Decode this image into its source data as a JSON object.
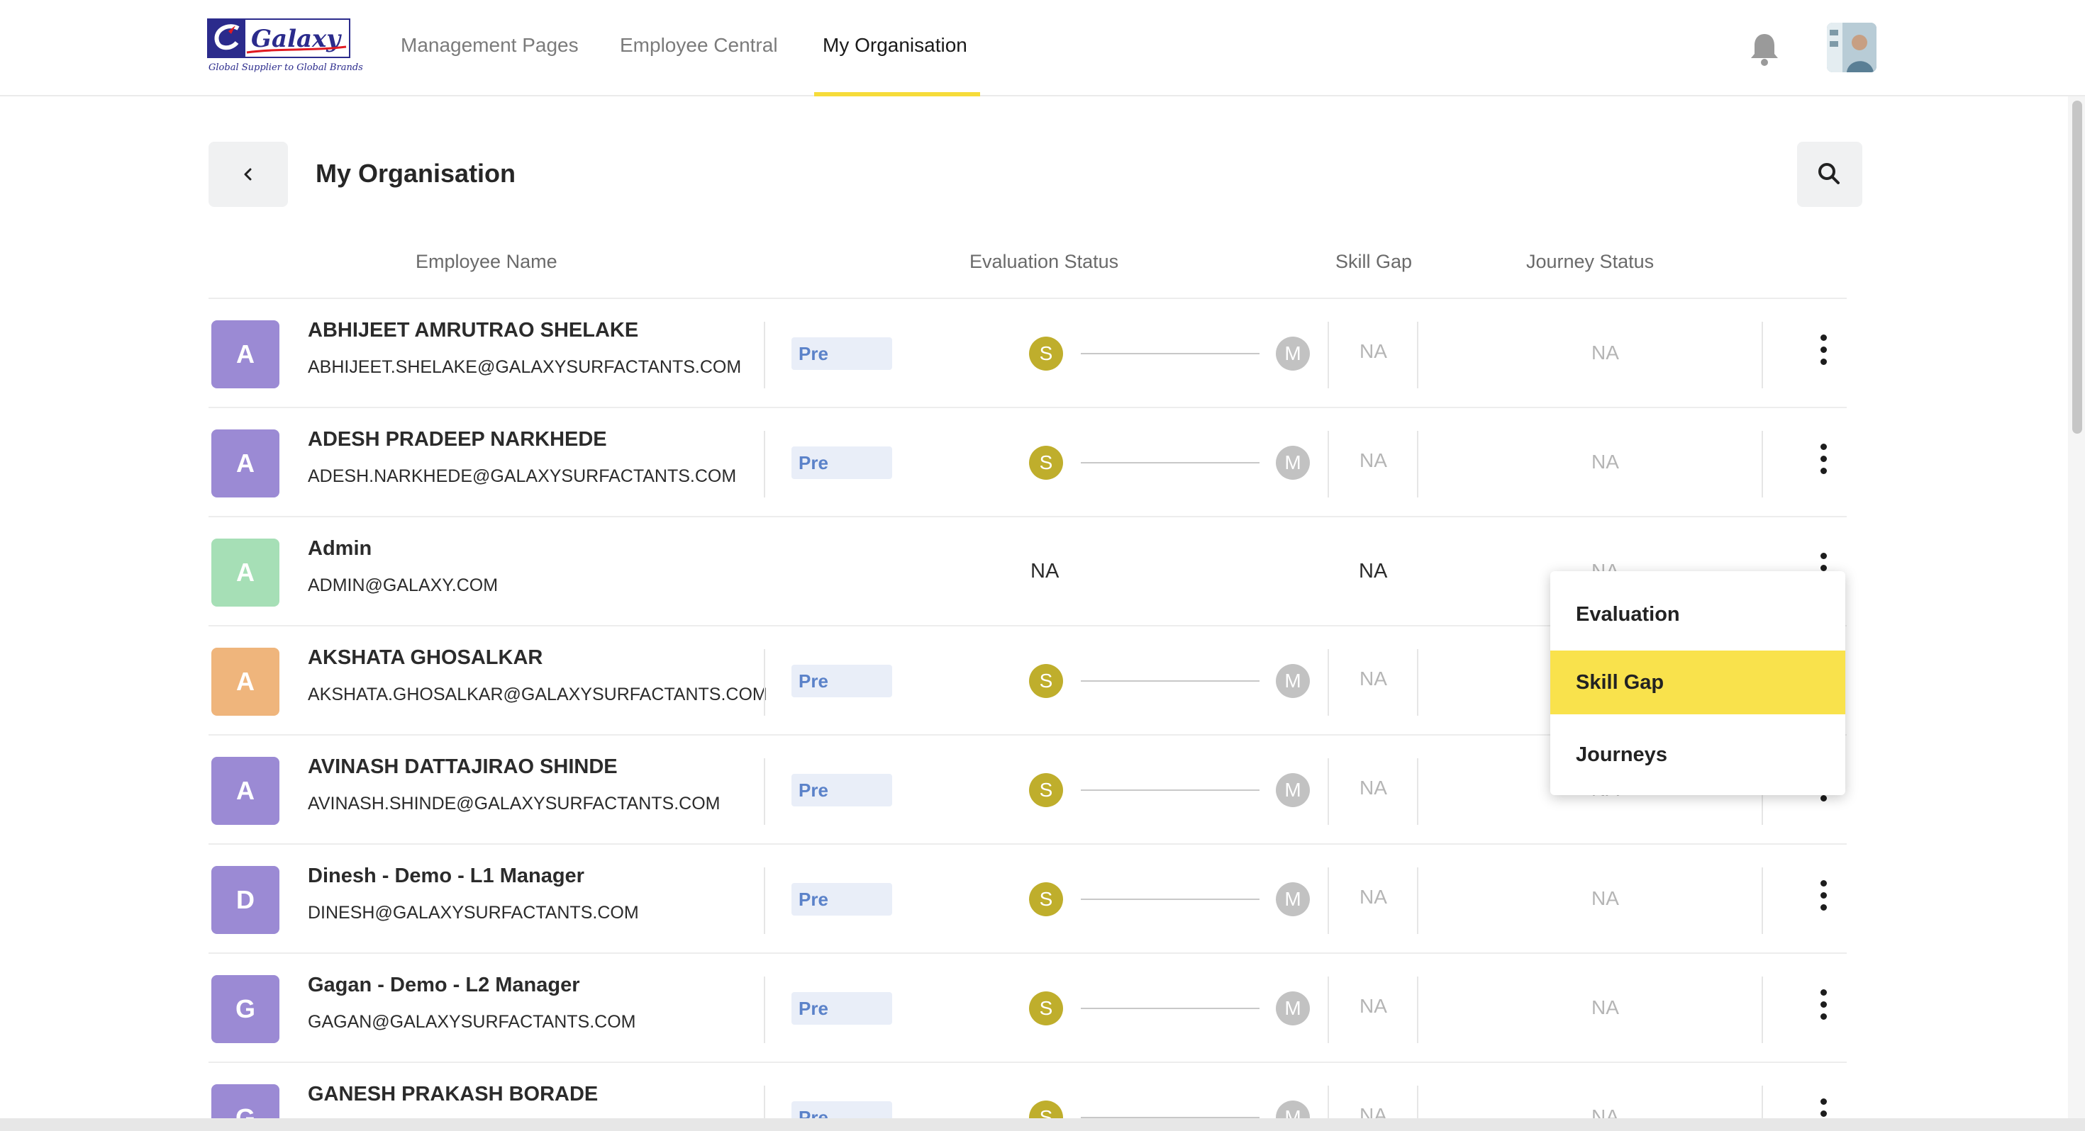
{
  "nav": {
    "logo_text": "Galaxy",
    "logo_tagline": "Global Supplier to Global Brands",
    "items": [
      "Management Pages",
      "Employee Central",
      "My Organisation"
    ],
    "active_index": 2,
    "accent_color": "#f6dc3a"
  },
  "page": {
    "title": "My Organisation",
    "back_icon": "chevron-left-icon",
    "search_icon": "search-icon"
  },
  "table": {
    "columns": {
      "employee": "Employee Name",
      "evaluation": "Evaluation Status",
      "skill_gap": "Skill Gap",
      "journey": "Journey Status"
    },
    "rows": [
      {
        "initial": "A",
        "color": "#9b8ad4",
        "name": "ABHIJEET AMRUTRAO SHELAKE",
        "email": "ABHIJEET.SHELAKE@GALAXYSURFACTANTS.COM",
        "badge": "Pre",
        "s": "S",
        "m": "M",
        "skill_gap": "NA",
        "journey": "NA"
      },
      {
        "initial": "A",
        "color": "#9b8ad4",
        "name": "ADESH PRADEEP NARKHEDE",
        "email": "ADESH.NARKHEDE@GALAXYSURFACTANTS.COM",
        "badge": "Pre",
        "s": "S",
        "m": "M",
        "skill_gap": "NA",
        "journey": "NA"
      },
      {
        "initial": "A",
        "color": "#a6dfb6",
        "name": "Admin",
        "email": "ADMIN@GALAXY.COM",
        "evaluation": "NA",
        "skill_gap": "NA",
        "journey": "NA"
      },
      {
        "initial": "A",
        "color": "#efb57c",
        "name": "AKSHATA GHOSALKAR",
        "email": "AKSHATA.GHOSALKAR@GALAXYSURFACTANTS.COM",
        "badge": "Pre",
        "s": "S",
        "m": "M",
        "skill_gap": "NA",
        "journey": "NA"
      },
      {
        "initial": "A",
        "color": "#9b8ad4",
        "name": "AVINASH DATTAJIRAO SHINDE",
        "email": "AVINASH.SHINDE@GALAXYSURFACTANTS.COM",
        "badge": "Pre",
        "s": "S",
        "m": "M",
        "skill_gap": "NA",
        "journey": "NA"
      },
      {
        "initial": "D",
        "color": "#9b8ad4",
        "name": "Dinesh - Demo - L1 Manager",
        "email": "DINESH@GALAXYSURFACTANTS.COM",
        "badge": "Pre",
        "s": "S",
        "m": "M",
        "skill_gap": "NA",
        "journey": "NA"
      },
      {
        "initial": "G",
        "color": "#9b8ad4",
        "name": "Gagan - Demo - L2 Manager",
        "email": "GAGAN@GALAXYSURFACTANTS.COM",
        "badge": "Pre",
        "s": "S",
        "m": "M",
        "skill_gap": "NA",
        "journey": "NA"
      },
      {
        "initial": "G",
        "color": "#9b8ad4",
        "name": "GANESH PRAKASH BORADE",
        "email": "",
        "badge": "Pre",
        "s": "S",
        "m": "M",
        "skill_gap": "NA",
        "journey": "NA"
      }
    ]
  },
  "menu": {
    "items": [
      "Evaluation",
      "Skill Gap",
      "Journeys"
    ],
    "highlighted_index": 1
  }
}
